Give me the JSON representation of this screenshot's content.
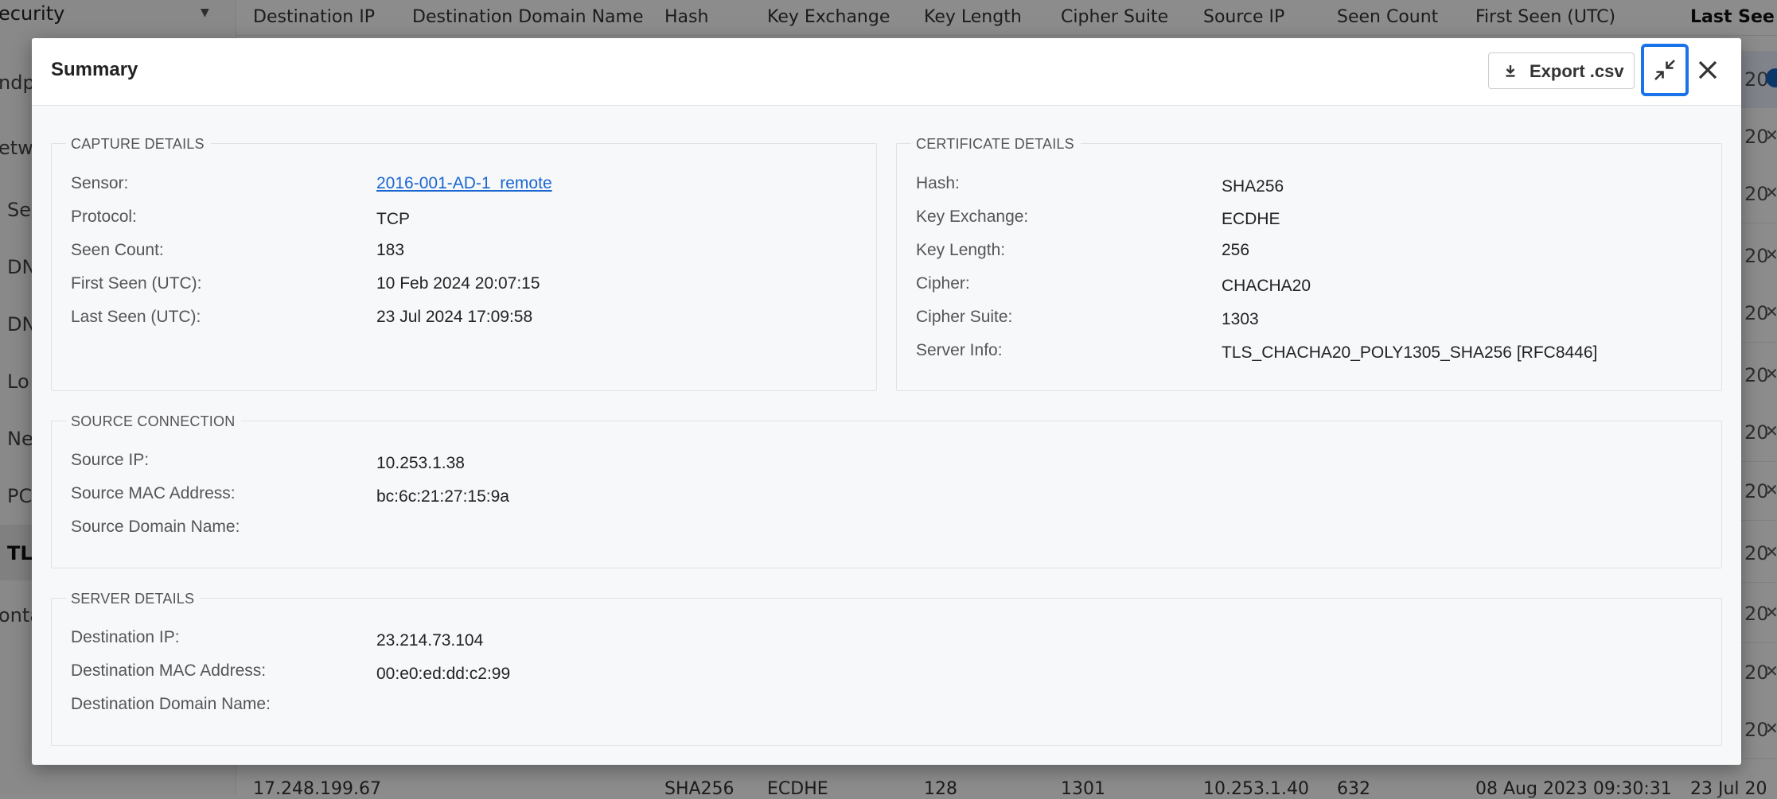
{
  "background": {
    "sidebar": {
      "top_label": "ecurity",
      "items": [
        "ndp",
        "etw",
        "Se",
        "DN",
        "DN",
        "Lo",
        "Ne",
        "PC",
        "TL",
        "onta"
      ]
    },
    "table": {
      "columns": [
        "Destination IP",
        "Destination Domain Name",
        "Hash",
        "Key Exchange",
        "Key Length",
        "Cipher Suite",
        "Source IP",
        "Seen Count",
        "First Seen (UTC)",
        "Last See"
      ],
      "row_tail": "20",
      "bottom_row": {
        "dest_ip": "17.248.199.67",
        "hash": "SHA256",
        "key_exchange": "ECDHE",
        "key_length": "128",
        "cipher_suite": "1301",
        "source_ip": "10.253.1.40",
        "seen_count": "632",
        "first_seen": "08 Aug 2023 09:30:31",
        "last_seen": "23 Jul 20"
      }
    }
  },
  "modal": {
    "title": "Summary",
    "export_label": "Export .csv",
    "capture": {
      "legend": "CAPTURE DETAILS",
      "fields": [
        {
          "label": "Sensor:",
          "value": "2016-001-AD-1_remote"
        },
        {
          "label": "Protocol:",
          "value": "TCP"
        },
        {
          "label": "Seen Count:",
          "value": "183"
        },
        {
          "label": "First Seen (UTC):",
          "value": "10 Feb 2024 20:07:15"
        },
        {
          "label": "Last Seen (UTC):",
          "value": "23 Jul 2024 17:09:58"
        }
      ]
    },
    "certificate": {
      "legend": "CERTIFICATE DETAILS",
      "fields": [
        {
          "label": "Hash:",
          "value": "SHA256"
        },
        {
          "label": "Key Exchange:",
          "value": "ECDHE"
        },
        {
          "label": "Key Length:",
          "value": "256"
        },
        {
          "label": "Cipher:",
          "value": "CHACHA20"
        },
        {
          "label": "Cipher Suite:",
          "value": "1303"
        },
        {
          "label": "Server Info:",
          "value": "TLS_CHACHA20_POLY1305_SHA256 [RFC8446]"
        }
      ]
    },
    "source": {
      "legend": "SOURCE CONNECTION",
      "fields": [
        {
          "label": "Source IP:",
          "value": "10.253.1.38"
        },
        {
          "label": "Source MAC Address:",
          "value": "bc:6c:21:27:15:9a"
        },
        {
          "label": "Source Domain Name:",
          "value": ""
        }
      ]
    },
    "server": {
      "legend": "SERVER DETAILS",
      "fields": [
        {
          "label": "Destination IP:",
          "value": "23.214.73.104"
        },
        {
          "label": "Destination MAC Address:",
          "value": "00:e0:ed:dd:c2:99"
        },
        {
          "label": "Destination Domain Name:",
          "value": ""
        }
      ]
    }
  },
  "colors": {
    "accent": "#1a73e8",
    "link": "#1a66d1",
    "overlay": "rgba(0,0,0,0.45)"
  }
}
